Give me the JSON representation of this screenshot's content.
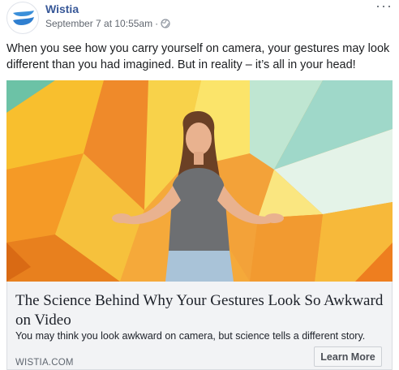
{
  "post": {
    "page_name": "Wistia",
    "timestamp": "September 7 at 10:55am",
    "separator": "·",
    "privacy_icon": "globe-icon",
    "more_icon": "ellipsis-icon",
    "more_glyph": "···",
    "text": "When you see how you carry yourself on camera, your gestures may look different than you had imagined. But in reality – it’s all in your head!"
  },
  "link_card": {
    "title": "The Science Behind Why Your Gestures Look So Awkward on Video",
    "description": "You may think you look awkward on camera, but science tells a different story.",
    "domain": "WISTIA.COM",
    "cta_label": "Learn More"
  },
  "colors": {
    "page_name": "#385898",
    "brand_blue": "#3a8fd9",
    "card_background": "#f2f3f5"
  }
}
